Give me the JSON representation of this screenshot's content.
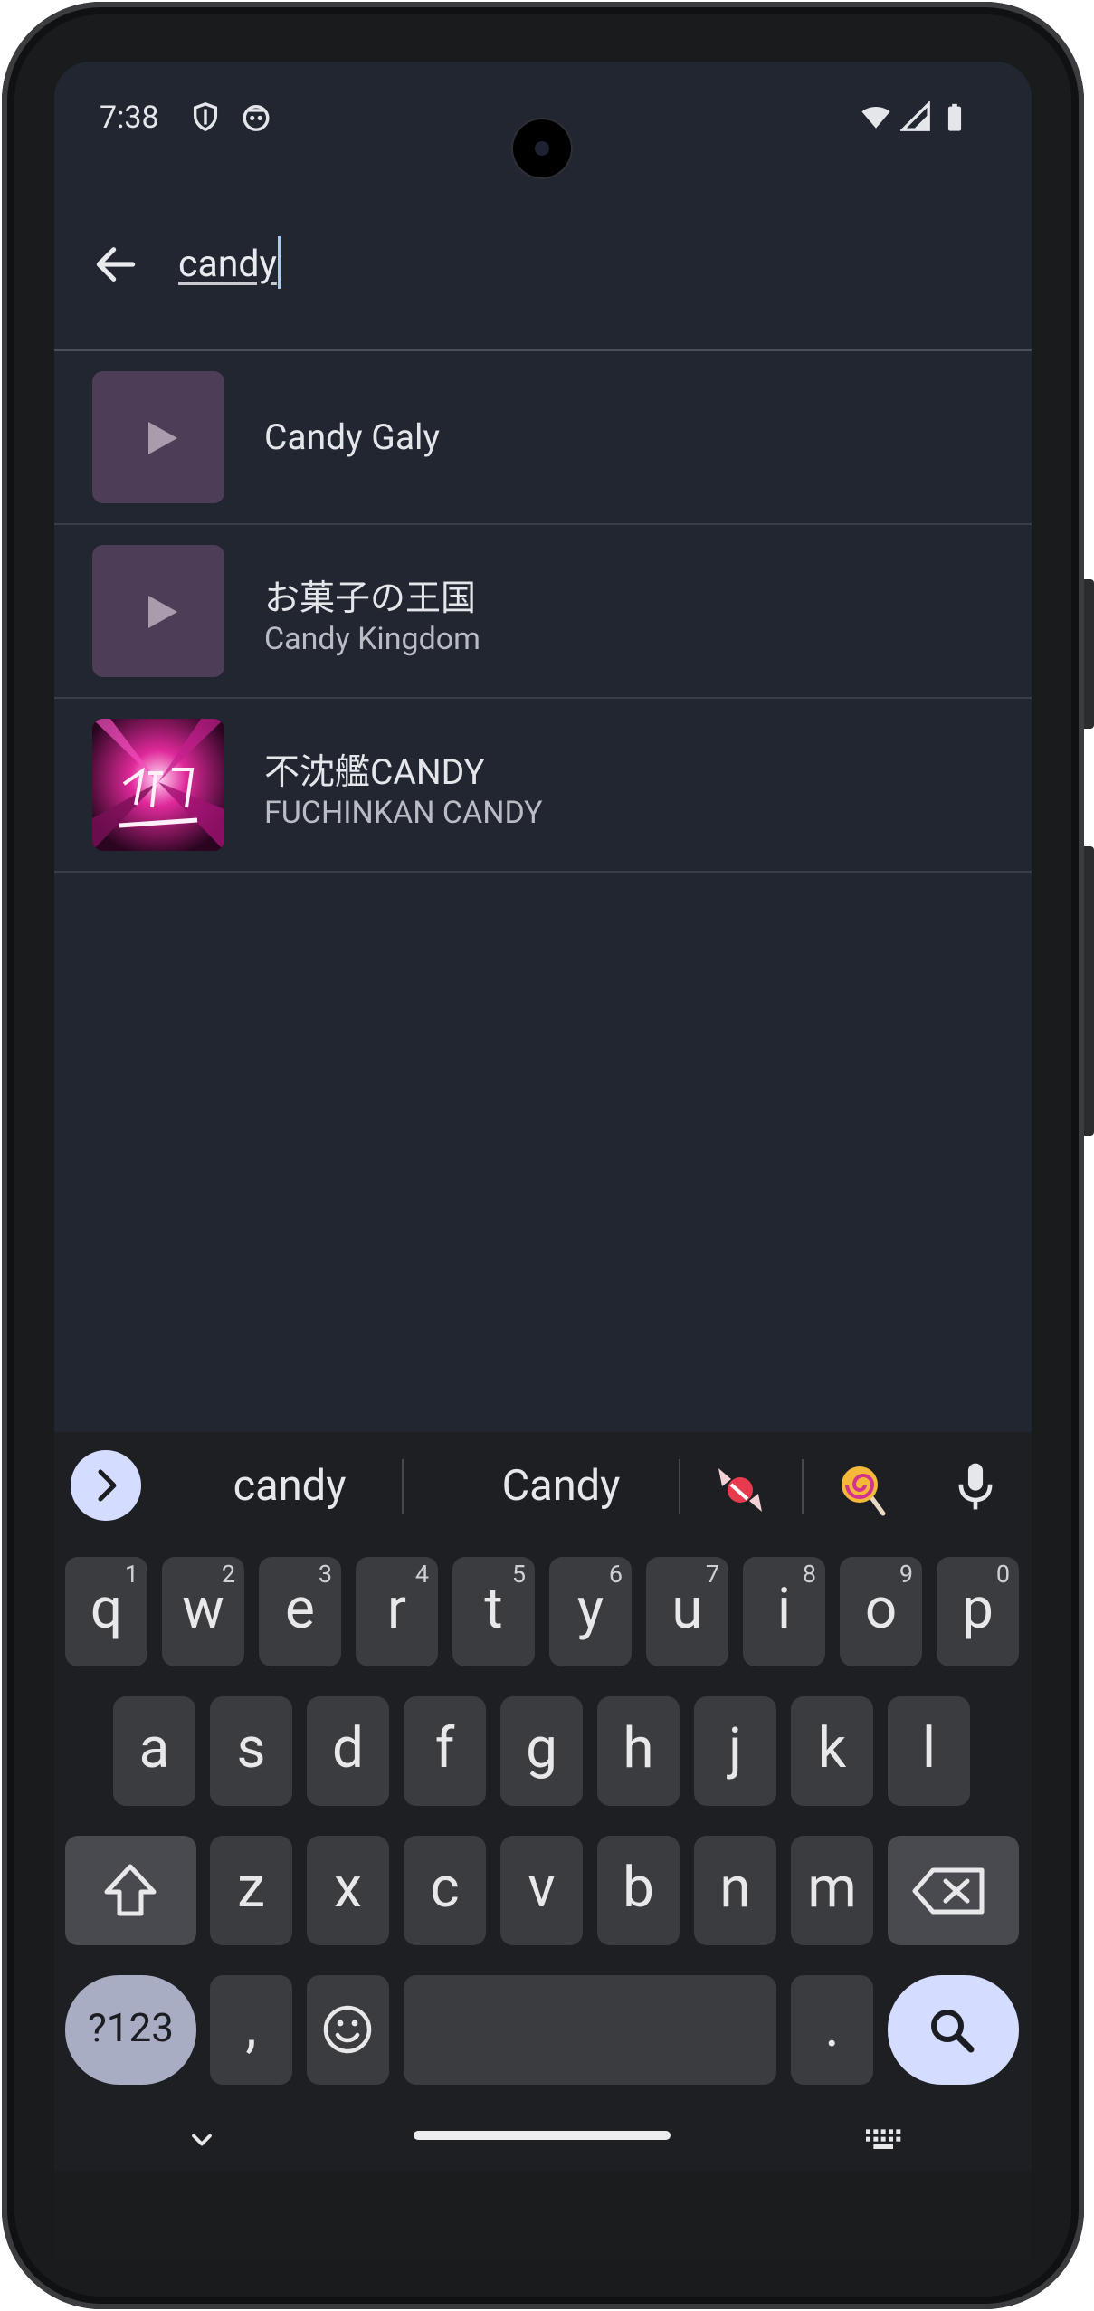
{
  "status_bar": {
    "time": "7:38",
    "left_icons": [
      "shield-icon",
      "bug-robot-icon"
    ],
    "right_icons": [
      "wifi-icon",
      "cell-signal-icon",
      "battery-icon"
    ]
  },
  "search": {
    "value": "candy",
    "back_icon": "arrow-back-icon"
  },
  "results": [
    {
      "title": "Candy Galy",
      "subtitle": "",
      "thumb": "play-placeholder"
    },
    {
      "title": "お菓子の王国",
      "subtitle": "Candy Kingdom",
      "thumb": "play-placeholder"
    },
    {
      "title": "不沈艦CANDY",
      "subtitle": "FUCHINKAN CANDY",
      "thumb": "album-art"
    }
  ],
  "keyboard": {
    "suggestions": [
      "candy",
      "Candy"
    ],
    "emoji_suggestions": [
      "candy-emoji-icon",
      "lollipop-emoji-icon"
    ],
    "row1": [
      {
        "k": "q",
        "h": "1"
      },
      {
        "k": "w",
        "h": "2"
      },
      {
        "k": "e",
        "h": "3"
      },
      {
        "k": "r",
        "h": "4"
      },
      {
        "k": "t",
        "h": "5"
      },
      {
        "k": "y",
        "h": "6"
      },
      {
        "k": "u",
        "h": "7"
      },
      {
        "k": "i",
        "h": "8"
      },
      {
        "k": "o",
        "h": "9"
      },
      {
        "k": "p",
        "h": "0"
      }
    ],
    "row2": [
      "a",
      "s",
      "d",
      "f",
      "g",
      "h",
      "j",
      "k",
      "l"
    ],
    "row3": [
      "z",
      "x",
      "c",
      "v",
      "b",
      "n",
      "m"
    ],
    "symbols_label": "?123",
    "comma_label": ",",
    "period_label": "."
  },
  "colors": {
    "background": "#212631",
    "keyboard": "#1e1f23",
    "key": "#3b3c40",
    "accent_key": "#d4dcff",
    "symbols_key": "#a9adc3",
    "thumb": "#4e3d57",
    "caret": "#a9c7ff"
  }
}
